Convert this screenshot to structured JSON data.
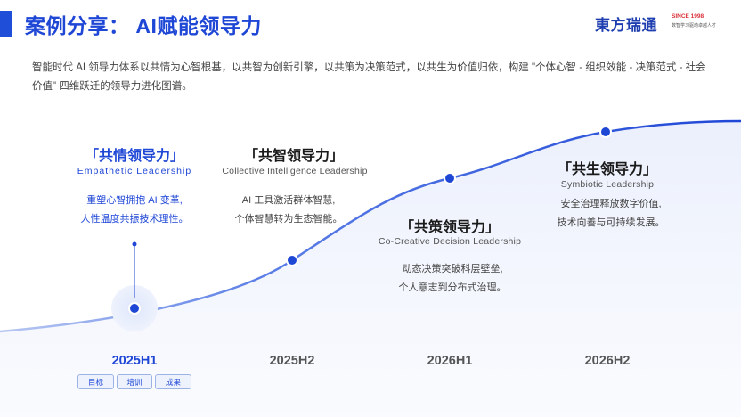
{
  "header": {
    "title": "案例分享： AI赋能领导力",
    "logo": {
      "name": "東方瑞通",
      "since": "SINCE 1998",
      "slogan": "数智学习驱动卓越人才"
    }
  },
  "intro": "智能时代 AI 领导力体系以共情为心智根基，以共智为创新引擎，以共策为决策范式，以共生为价值归依，构建 \"个体心智 - 组织效能 - 决策范式 - 社会价值\" 四维跃迁的领导力进化图谱。",
  "stages": [
    {
      "title": "「共情领导力」",
      "en": "Empathetic Leadership",
      "desc1": "重塑心智拥抱 AI 变革,",
      "desc2": "人性温度共振技术理性。",
      "period": "2025H1",
      "active": true
    },
    {
      "title": "「共智领导力」",
      "en": "Collective Intelligence Leadership",
      "desc1": "AI 工具激活群体智慧,",
      "desc2": "个体智慧转为生态智能。",
      "period": "2025H2",
      "active": false
    },
    {
      "title": "「共策领导力」",
      "en": "Co-Creative Decision Leadership",
      "desc1": "动态决策突破科层壁垒,",
      "desc2": "个人意志到分布式治理。",
      "period": "2026H1",
      "active": false
    },
    {
      "title": "「共生领导力」",
      "en": "Symbiotic Leadership",
      "desc1": "安全治理释放数字价值,",
      "desc2": "技术向善与可持续发展。",
      "period": "2026H2",
      "active": false
    }
  ],
  "tags": [
    "目标",
    "培训",
    "成果"
  ],
  "colors": {
    "accent": "#1f47d6",
    "text": "#333333",
    "muted": "#555555"
  }
}
